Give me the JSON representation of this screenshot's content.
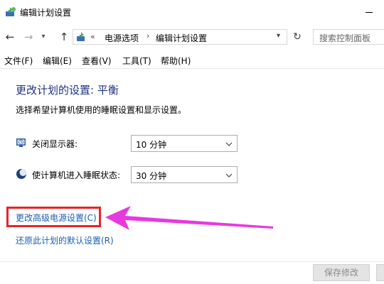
{
  "window": {
    "title": "编辑计划设置"
  },
  "address_bar": {
    "chevron": "«",
    "crumbs": [
      "电源选项",
      "编辑计划设置"
    ],
    "separator": "›"
  },
  "search": {
    "placeholder": "搜索控制面板"
  },
  "menu": [
    {
      "label": "文件(F)"
    },
    {
      "label": "编辑(E)"
    },
    {
      "label": "查看(V)"
    },
    {
      "label": "工具(T)"
    },
    {
      "label": "帮助(H)"
    }
  ],
  "main": {
    "title": "更改计划的设置: 平衡",
    "description": "选择希望计算机使用的睡眠设置和显示设置。",
    "settings": [
      {
        "label": "关闭显示器:",
        "value": "10 分钟",
        "icon": "monitor-timer-icon"
      },
      {
        "label": "使计算机进入睡眠状态:",
        "value": "30 分钟",
        "icon": "sleep-moon-icon"
      }
    ],
    "links": [
      {
        "label": "更改高级电源设置(C)"
      },
      {
        "label": "还原此计划的默认设置(R)"
      }
    ]
  },
  "buttons": {
    "save": "保存修改",
    "cancel": ""
  },
  "colors": {
    "title": "#1e3287",
    "link": "#1a5fb4",
    "highlight": "#e8242a",
    "arrow": "#e838e0"
  }
}
